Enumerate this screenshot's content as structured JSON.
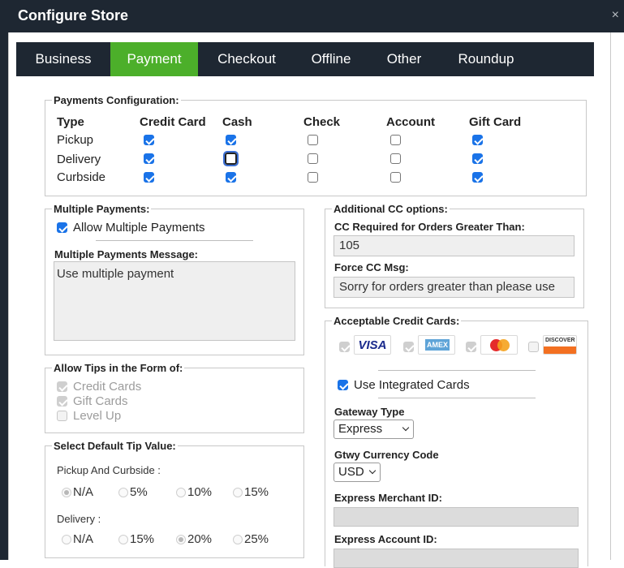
{
  "window": {
    "title": "Configure Store",
    "close_glyph": "×"
  },
  "tabs": [
    {
      "label": "Business",
      "active": false
    },
    {
      "label": "Payment",
      "active": true
    },
    {
      "label": "Checkout",
      "active": false
    },
    {
      "label": "Offline",
      "active": false
    },
    {
      "label": "Other",
      "active": false
    },
    {
      "label": "Roundup",
      "active": false
    }
  ],
  "payments_config": {
    "legend": "Payments Configuration:",
    "columns": [
      "Type",
      "Credit Card",
      "Cash",
      "Check",
      "Account",
      "Gift Card"
    ],
    "rows": [
      {
        "type": "Pickup",
        "credit_card": true,
        "cash": true,
        "check": false,
        "account": false,
        "gift_card": true
      },
      {
        "type": "Delivery",
        "credit_card": true,
        "cash": false,
        "check": false,
        "account": false,
        "gift_card": true
      },
      {
        "type": "Curbside",
        "credit_card": true,
        "cash": true,
        "check": false,
        "account": false,
        "gift_card": true
      }
    ]
  },
  "multiple_payments": {
    "legend": "Multiple Payments:",
    "allow_label": "Allow Multiple Payments",
    "allow_checked": true,
    "message_label": "Multiple Payments Message:",
    "message_value": "Use multiple payment"
  },
  "tips_form": {
    "legend": "Allow Tips in the Form of:",
    "options": [
      {
        "label": "Credit Cards",
        "checked": true
      },
      {
        "label": "Gift Cards",
        "checked": true
      },
      {
        "label": "Level Up",
        "checked": false
      }
    ]
  },
  "default_tip": {
    "legend": "Select Default Tip Value:",
    "pickup_label": "Pickup And Curbside :",
    "pickup_options": [
      "N/A",
      "5%",
      "10%",
      "15%"
    ],
    "pickup_selected": "N/A",
    "delivery_label": "Delivery :",
    "delivery_options": [
      "N/A",
      "15%",
      "20%",
      "25%"
    ],
    "delivery_selected": "20%"
  },
  "additional_cc": {
    "legend": "Additional CC options:",
    "required_label": "CC Required for Orders Greater Than:",
    "required_value": "105",
    "force_msg_label": "Force CC Msg:",
    "force_msg_value": "Sorry for orders greater than please use"
  },
  "acceptable_cards": {
    "legend": "Acceptable Credit Cards:",
    "cards": [
      {
        "name": "VISA",
        "checked": true
      },
      {
        "name": "AMEX",
        "checked": true
      },
      {
        "name": "MasterCard",
        "checked": true
      },
      {
        "name": "DISCOVER",
        "checked": false
      }
    ],
    "integrated_label": "Use Integrated Cards",
    "integrated_checked": true,
    "gateway_label": "Gateway Type",
    "gateway_value": "Express",
    "currency_label": "Gtwy Currency Code",
    "currency_value": "USD",
    "merchant_label": "Express Merchant ID:",
    "merchant_value": "",
    "account_label": "Express Account ID:",
    "account_value": ""
  },
  "colors": {
    "tab_bar": "#1e2732",
    "tab_active": "#4caf2a",
    "checkbox": "#1a73e8"
  }
}
